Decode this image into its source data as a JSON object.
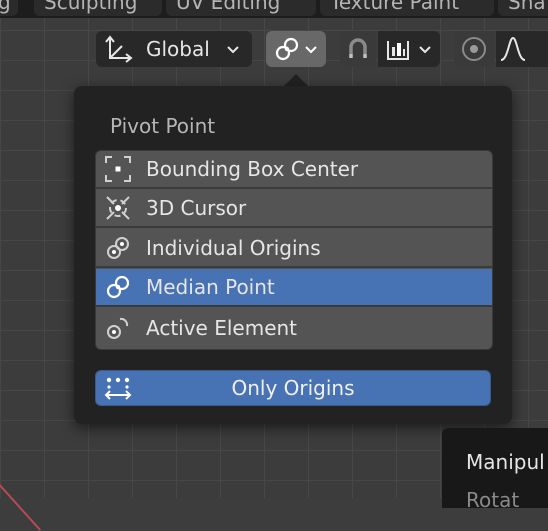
{
  "workspace_tabs": [
    "Sculpting",
    "UV Editing",
    "Texture Paint",
    "Sha"
  ],
  "header": {
    "orientation_label": "Global",
    "pivot_icon": "median-point-icon",
    "snap_icon": "magnet-icon",
    "snap_target_icon": "snap-increment-icon",
    "proportional_icon": "proportional-edit-icon",
    "falloff_icon": "falloff-curve-icon"
  },
  "popup": {
    "title": "Pivot Point",
    "items": [
      {
        "label": "Bounding Box Center",
        "icon": "bounding-box-center-icon",
        "selected": false
      },
      {
        "label": "3D Cursor",
        "icon": "3d-cursor-icon",
        "selected": false
      },
      {
        "label": "Individual Origins",
        "icon": "individual-origins-icon",
        "selected": false
      },
      {
        "label": "Median Point",
        "icon": "median-point-icon",
        "selected": true
      },
      {
        "label": "Active Element",
        "icon": "active-element-icon",
        "selected": false
      }
    ],
    "only_origins_label": "Only Origins"
  },
  "tooltip": {
    "title": "Manipul",
    "subtitle": "Rotat"
  },
  "colors": {
    "accent": "#4772b3",
    "popup_bg": "#222222",
    "item_bg": "#545454"
  }
}
